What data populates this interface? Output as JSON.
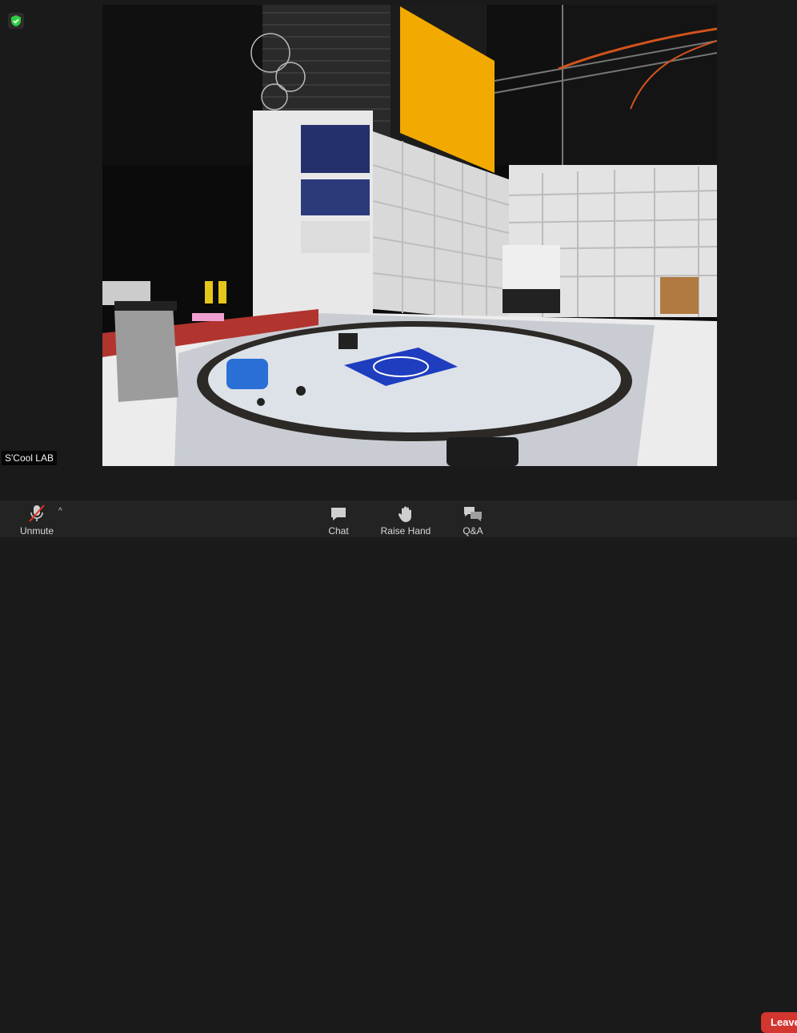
{
  "participant": {
    "name": "S'Cool LAB"
  },
  "video": {
    "description_icon": "video-feed"
  },
  "security": {
    "icon": "shield-check-icon",
    "color": "#2ecc40"
  },
  "toolbar": {
    "unmute_label": "Unmute",
    "chat_label": "Chat",
    "raise_hand_label": "Raise Hand",
    "qa_label": "Q&A",
    "leave_label": "Leave"
  },
  "colors": {
    "leave": "#d3352f",
    "toolbar": "#232323",
    "banner": "#f2a900",
    "cern_logo": "#1e3dbf"
  }
}
